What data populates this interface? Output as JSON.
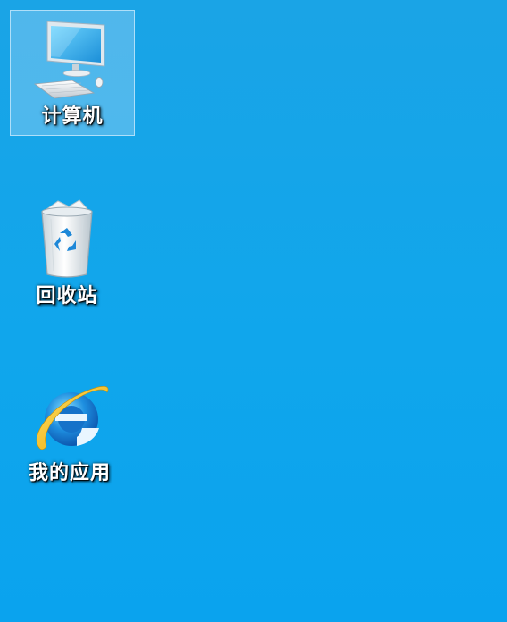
{
  "desktop": {
    "background_color": "#10a6ec",
    "icons": [
      {
        "label": "计算机",
        "icon": "computer-icon",
        "selected": true
      },
      {
        "label": "回收站",
        "icon": "recycle-bin-icon",
        "selected": false
      },
      {
        "label": "我的应用",
        "icon": "internet-explorer-icon",
        "selected": false
      }
    ]
  }
}
